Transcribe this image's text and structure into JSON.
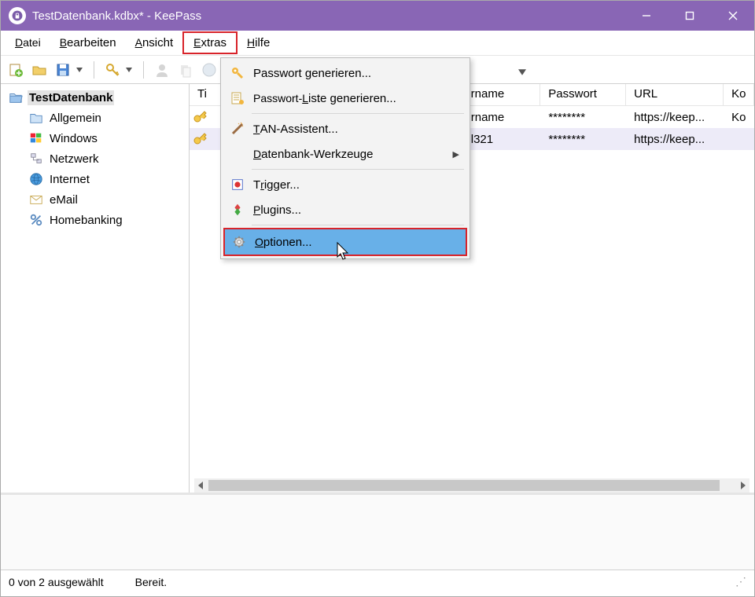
{
  "window": {
    "title": "TestDatenbank.kdbx* - KeePass"
  },
  "menubar": {
    "datei": "Datei",
    "bearbeiten": "Bearbeiten",
    "ansicht": "Ansicht",
    "extras": "Extras",
    "hilfe": "Hilfe"
  },
  "extras_menu": {
    "passwort_gen": "Passwort generieren...",
    "passwort_liste": "Passwort-Liste generieren...",
    "tan": "TAN-Assistent...",
    "db_tools": "Datenbank-Werkzeuge",
    "trigger": "Trigger...",
    "plugins": "Plugins...",
    "optionen": "Optionen..."
  },
  "tree": {
    "root": "TestDatenbank",
    "items": [
      {
        "label": "Allgemein",
        "icon": "folder"
      },
      {
        "label": "Windows",
        "icon": "windows"
      },
      {
        "label": "Netzwerk",
        "icon": "network"
      },
      {
        "label": "Internet",
        "icon": "globe"
      },
      {
        "label": "eMail",
        "icon": "mail"
      },
      {
        "label": "Homebanking",
        "icon": "percent"
      }
    ]
  },
  "columns": {
    "title": "Ti",
    "username": "ername",
    "password": "Passwort",
    "url": "URL",
    "kommentar": "Ko"
  },
  "rows": [
    {
      "username_fragment": "ername",
      "password": "********",
      "url": "https://keep...",
      "kom": "Ko"
    },
    {
      "username_fragment": "el321",
      "password": "********",
      "url": "https://keep...",
      "kom": ""
    }
  ],
  "status": {
    "selection": "0 von 2 ausgewählt",
    "ready": "Bereit."
  }
}
